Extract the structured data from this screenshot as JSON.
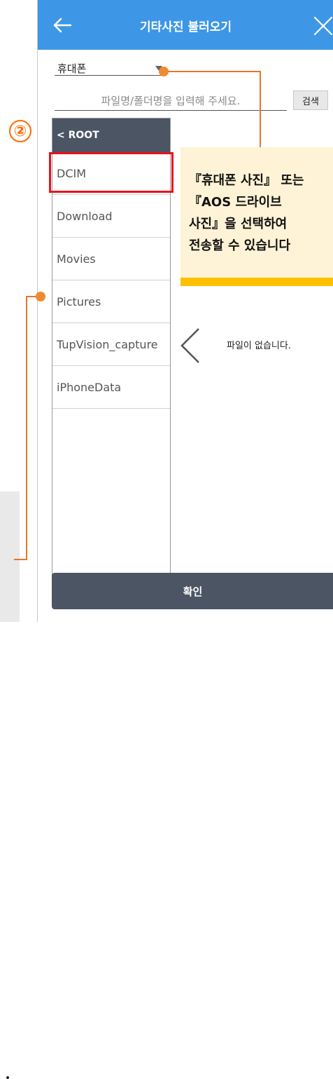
{
  "header": {
    "title": "기타사진 불러오기",
    "back_icon": "arrow-left-icon",
    "close_icon": "close-icon",
    "color": "#3d97e6"
  },
  "storage": {
    "selected": "휴대폰"
  },
  "search": {
    "placeholder": "파일명/폴더명을 입력해 주세요.",
    "value": "",
    "button_label": "검색"
  },
  "folders": {
    "root_label": "< ROOT",
    "items": [
      "DCIM",
      "Download",
      "Movies",
      "Pictures",
      "TupVision_capture",
      "iPhoneData"
    ]
  },
  "files": {
    "empty_message": "파일이 없습니다."
  },
  "confirm_label": "확인",
  "annotation": {
    "step_number": "②",
    "callout_text": "『휴대폰 사진』 또는\n『AOS 드라이브\n사진』을 선택하여\n전송할 수 있습니다",
    "accent_color": "#f08a2e",
    "highlight_color": "#e8121d"
  },
  "colors": {
    "dark_panel": "#4b5563",
    "callout_bg": "#fef3d6",
    "callout_bar": "#ffc000"
  }
}
